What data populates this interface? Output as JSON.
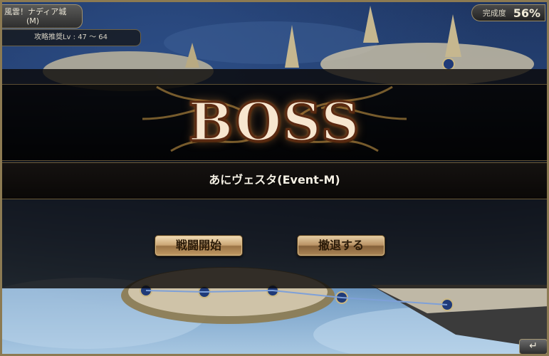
{
  "area": {
    "name_line1": "風雲！ナディア城",
    "name_line2": "(M)",
    "recommended_level": "攻略推奨Lv : 47 ～ 64"
  },
  "completion": {
    "label": "完成度",
    "value": "56%"
  },
  "dialog": {
    "title": "BOSS",
    "boss_name": "あにヴェスタ(Event-M)",
    "start_button": "戦闘開始",
    "retreat_button": "撤退する"
  },
  "back_button": {
    "icon": "return-arrow-icon",
    "glyph": "↵"
  },
  "colors": {
    "button_gold": "#caa574",
    "title_cream": "#f7e6cf",
    "frame_gold": "#8c7a52"
  }
}
